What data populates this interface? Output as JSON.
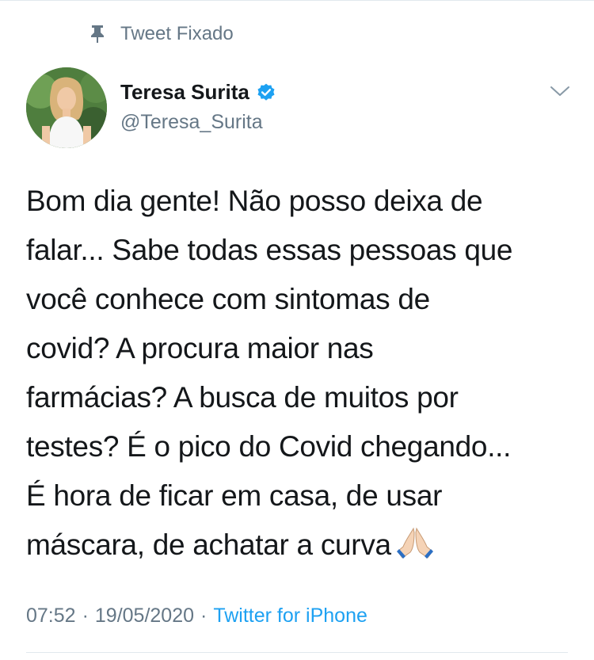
{
  "pinned": {
    "label": "Tweet Fixado",
    "icon": "pin-icon"
  },
  "author": {
    "name": "Teresa Surita",
    "handle": "@Teresa_Surita",
    "verified_icon": "verified-badge-icon"
  },
  "tweet": {
    "lines": [
      "Bom dia gente! Não posso deixa de",
      "falar... Sabe todas essas pessoas que",
      "você conhece com sintomas de",
      "covid? A procura maior nas",
      "farmácias? A busca de muitos por",
      "testes? É o pico do Covid chegando...",
      "É hora de ficar em casa, de usar",
      "máscara, de achatar a curva"
    ],
    "emoji_icon": "folded-hands-icon"
  },
  "meta": {
    "time": "07:52",
    "separator": "·",
    "date": "19/05/2020",
    "source": "Twitter for iPhone"
  },
  "colors": {
    "text": "#14171a",
    "secondary": "#657786",
    "accent": "#1da1f2",
    "divider": "#e1e8ed"
  }
}
